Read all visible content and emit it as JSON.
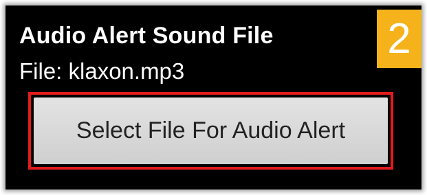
{
  "setting": {
    "title": "Audio Alert Sound File",
    "file_label": "File: klaxon.mp3",
    "button_label": "Select File For Audio Alert"
  },
  "step_badge": {
    "number": "2",
    "color": "#f5b21a"
  },
  "colors": {
    "highlight": "#e21b1b",
    "background": "#000000",
    "button": "#d9d9d9"
  }
}
